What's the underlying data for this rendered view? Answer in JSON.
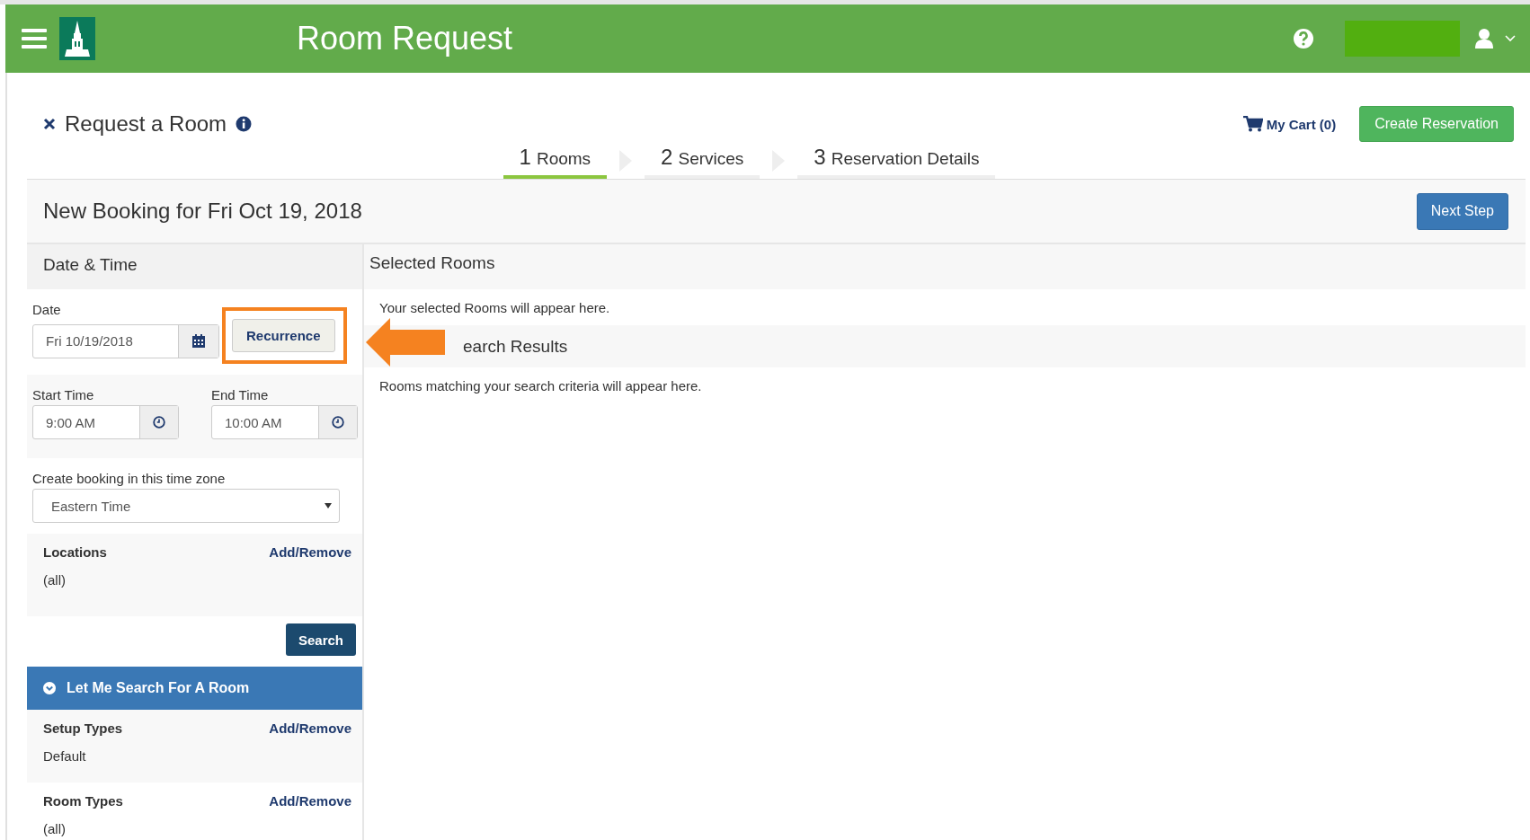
{
  "header": {
    "title": "Room Request"
  },
  "page": {
    "title": "Request a Room",
    "cart": "My Cart (0)",
    "create_button": "Create Reservation"
  },
  "steps": [
    {
      "number": "1",
      "label": "Rooms",
      "selected": true
    },
    {
      "number": "2",
      "label": "Services",
      "selected": false
    },
    {
      "number": "3",
      "label": "Reservation Details",
      "selected": false
    }
  ],
  "booking": {
    "title": "New Booking for Fri Oct 19, 2018",
    "next_button": "Next Step"
  },
  "date_time": {
    "heading": "Date & Time",
    "date_label": "Date",
    "date_value": "Fri 10/19/2018",
    "recurrence_button": "Recurrence",
    "start_label": "Start Time",
    "start_value": "9:00 AM",
    "end_label": "End Time",
    "end_value": "10:00 AM",
    "timezone_label": "Create booking in this time zone",
    "timezone_value": "Eastern Time"
  },
  "filters": [
    {
      "label": "Locations",
      "action": "Add/Remove",
      "value": "(all)"
    }
  ],
  "search_button": "Search",
  "search_section": {
    "title": "Let Me Search For A Room",
    "expanded": true
  },
  "room_filters": [
    {
      "label": "Setup Types",
      "action": "Add/Remove",
      "value": "Default"
    },
    {
      "label": "Room Types",
      "action": "Add/Remove",
      "value": "(all)"
    }
  ],
  "selected_rooms": {
    "heading": "Selected Rooms",
    "message": "Your selected Rooms will appear here."
  },
  "search_results": {
    "heading": "earch Results",
    "message": "Rooms matching your search criteria will appear here."
  }
}
